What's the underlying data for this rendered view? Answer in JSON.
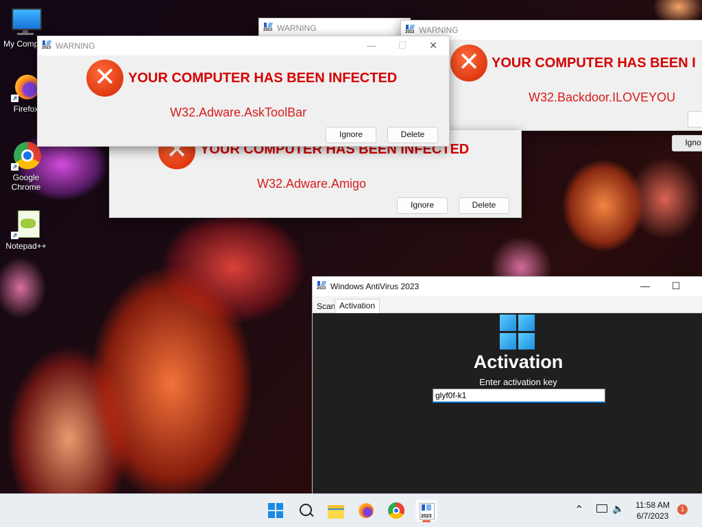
{
  "desktop": {
    "icons": [
      {
        "label": "My Comp",
        "icon": "monitor-icon"
      },
      {
        "label": "Firefox",
        "icon": "firefox-icon"
      },
      {
        "label": "Google Chrome",
        "icon": "chrome-icon"
      },
      {
        "label": "Notepad++",
        "icon": "notepadpp-icon"
      }
    ]
  },
  "warnings": [
    {
      "title": "WARNING",
      "headline": "YOUR COMPUTER HAS BEEN INFECTED",
      "threat": "W32.Adware.AskToolBar",
      "ignore": "Ignore",
      "delete": "Delete"
    },
    {
      "title": "WARNING",
      "headline": "YOUR COMPUTER HAS BEEN INFECTED",
      "threat": "W32.Adware.Amigo",
      "ignore": "Ignore",
      "delete": "Delete"
    },
    {
      "title": "WARNING",
      "headline": "YOUR COMPUTER HAS BEEN I",
      "threat": "W32.Backdoor.ILOVEYOU",
      "ignore": "Igno"
    },
    {
      "title": "WARNING"
    }
  ],
  "antivirus": {
    "title": "Windows AntiVirus 2023",
    "tabs": [
      "Scan",
      "Activation"
    ],
    "active_tab": "Activation",
    "heading": "Activation",
    "prompt": "Enter activation key",
    "key_value": "glyf0f-k1"
  },
  "taskbar": {
    "time": "11:58 AM",
    "date": "6/7/2023",
    "notification_count": "1",
    "apps": [
      "start-icon",
      "search-icon",
      "file-explorer-icon",
      "firefox-icon",
      "chrome-icon",
      "antivirus-2023-icon"
    ]
  },
  "colors": {
    "alert_red": "#d50000",
    "error_orange": "#e03a12",
    "accent_blue": "#0067c0"
  }
}
